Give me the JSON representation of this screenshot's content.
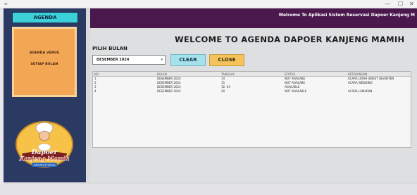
{
  "window": {
    "close_glyph": "✕",
    "minimize_glyph": "—",
    "restore_glyph": "☐"
  },
  "sidebar": {
    "agenda_tab": "AGENDA",
    "menu_items": [
      "AGENDA VENUE",
      "SETIAP BULAN"
    ],
    "logo_text": {
      "line1": "Dapoer",
      "line2": "Kanjeng Mamih",
      "line3": "Catering & Venue"
    }
  },
  "header": {
    "welcome": "Welcome To Aplikasi Sistem Reservasi Dapoer Kanjeng M"
  },
  "main": {
    "title": "WELCOME TO AGENDA DAPOER KANJENG MAMIH",
    "pilih_label": "PILIH BULAN",
    "month_select": "DESEMBER 2024",
    "clear_label": "CLEAR",
    "close_label": "CLOSE"
  },
  "table": {
    "headers": [
      "NO",
      "BULAN",
      "TANGGAL",
      "STATUS",
      "KETERANGAN"
    ],
    "rows": [
      [
        "1",
        "DESEMBER 2024",
        "14",
        "NOT AVAILABE",
        "ACARA ULTAH SWEET SEVENTEN"
      ],
      [
        "2",
        "DESEMBER 2024",
        "15",
        "NOT AVAILABE",
        "ACARA WEDDING"
      ],
      [
        "3",
        "DESEMBER 2024",
        "16 -03",
        "AVAILABLE",
        "-"
      ],
      [
        "4",
        "DESEMBER 2024",
        "20",
        "NOT AVAILABLE",
        "ACARA LAMARAN"
      ]
    ]
  },
  "colors": {
    "sidebar": "#2b3a63",
    "header": "#4a184d",
    "agenda_tab": "#3cd1d9",
    "menu_box": "#f3a653",
    "clear": "#a6e2ec",
    "close": "#f5c35b"
  }
}
